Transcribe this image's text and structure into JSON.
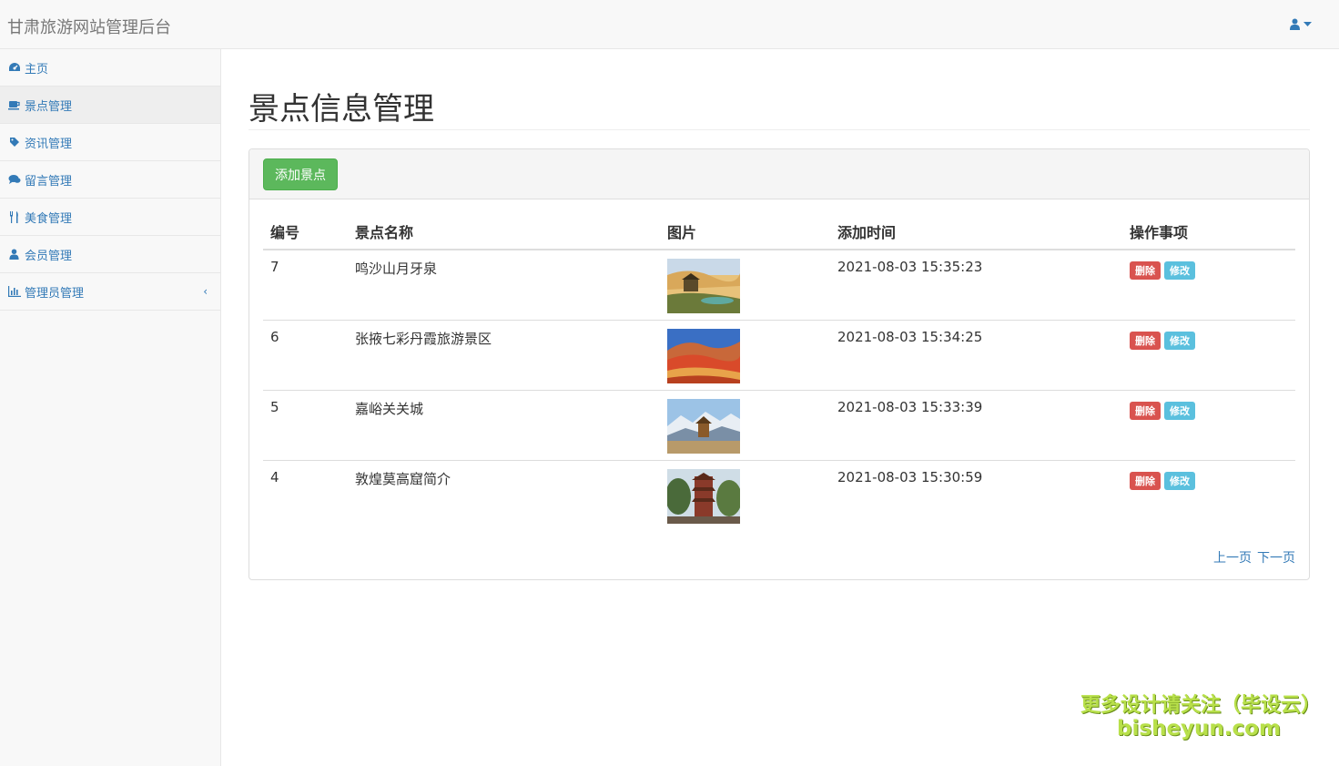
{
  "navbar": {
    "brand": "甘肃旅游网站管理后台",
    "user_icon": "user-icon",
    "caret_icon": "caret-down-icon"
  },
  "sidebar": {
    "items": [
      {
        "label": "主页",
        "icon": "dashboard-icon"
      },
      {
        "label": "景点管理",
        "icon": "coffee-icon"
      },
      {
        "label": "资讯管理",
        "icon": "tag-icon"
      },
      {
        "label": "留言管理",
        "icon": "comments-icon"
      },
      {
        "label": "美食管理",
        "icon": "cutlery-icon"
      },
      {
        "label": "会员管理",
        "icon": "user-icon"
      },
      {
        "label": "管理员管理",
        "icon": "bar-chart-icon"
      }
    ],
    "chevron": "‹"
  },
  "main": {
    "title": "景点信息管理",
    "add_button": "添加景点",
    "table": {
      "headers": [
        "编号",
        "景点名称",
        "图片",
        "添加时间",
        "操作事项"
      ],
      "rows": [
        {
          "id": "7",
          "name": "鸣沙山月牙泉",
          "time": "2021-08-03 15:35:23"
        },
        {
          "id": "6",
          "name": "张掖七彩丹霞旅游景区",
          "time": "2021-08-03 15:34:25"
        },
        {
          "id": "5",
          "name": "嘉峪关关城",
          "time": "2021-08-03 15:33:39"
        },
        {
          "id": "4",
          "name": "敦煌莫高窟简介",
          "time": "2021-08-03 15:30:59"
        }
      ],
      "delete_label": "删除",
      "edit_label": "修改"
    },
    "pager": {
      "prev": "上一页",
      "next": "下一页"
    }
  },
  "watermark": {
    "line1": "更多设计请关注（毕设云）",
    "line2": "bisheyun.com"
  },
  "colors": {
    "link": "#337ab7",
    "success": "#5cb85c",
    "danger": "#d9534f",
    "info": "#5bc0de"
  }
}
